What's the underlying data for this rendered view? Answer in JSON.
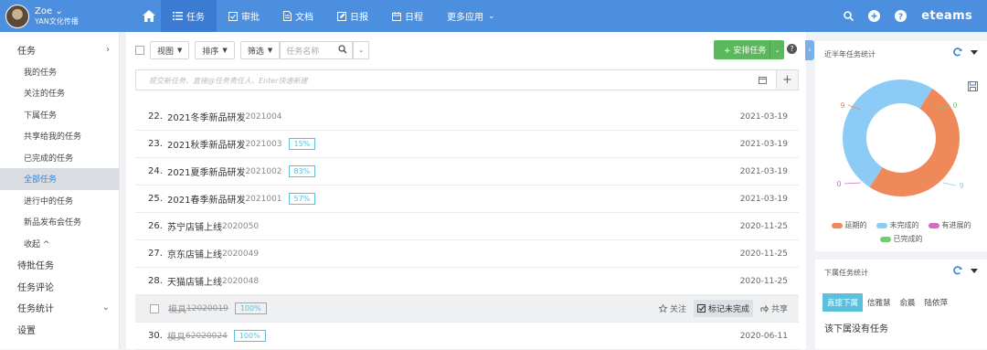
{
  "user": {
    "name": "Zoe",
    "org": "YAN文化传播"
  },
  "nav": {
    "items": [
      "任务",
      "审批",
      "文档",
      "日报",
      "日程",
      "更多应用"
    ],
    "brand": "eteams"
  },
  "sidebar": {
    "items": [
      {
        "label": "任务",
        "sub": false,
        "arrow": "›"
      },
      {
        "label": "我的任务",
        "sub": true
      },
      {
        "label": "关注的任务",
        "sub": true
      },
      {
        "label": "下属任务",
        "sub": true
      },
      {
        "label": "共享给我的任务",
        "sub": true
      },
      {
        "label": "已完成的任务",
        "sub": true
      },
      {
        "label": "全部任务",
        "sub": true,
        "active": true
      },
      {
        "label": "进行中的任务",
        "sub": true
      },
      {
        "label": "新品发布会任务",
        "sub": true
      },
      {
        "label": "收起 ^",
        "sub": true
      },
      {
        "label": "待批任务",
        "sub": false
      },
      {
        "label": "任务评论",
        "sub": false
      },
      {
        "label": "任务统计",
        "sub": false,
        "arrow": "⌄"
      },
      {
        "label": "设置",
        "sub": false
      }
    ]
  },
  "toolbar": {
    "view": "视图",
    "sort": "排序",
    "filter": "筛选",
    "search_placeholder": "任务名称",
    "add": "+ 安排任务"
  },
  "quick": {
    "placeholder": "提交新任务、直接@任务责任人、Enter快速新建"
  },
  "tasks": [
    {
      "num": "22.",
      "title": "2021冬季新品研发",
      "code": "2021004",
      "pct": "",
      "date": "2021-03-19",
      "done": false
    },
    {
      "num": "23.",
      "title": "2021秋季新品研发",
      "code": "2021003",
      "pct": "15%",
      "date": "2021-03-19",
      "done": false
    },
    {
      "num": "24.",
      "title": "2021夏季新品研发",
      "code": "2021002",
      "pct": "83%",
      "date": "2021-03-19",
      "done": false
    },
    {
      "num": "25.",
      "title": "2021春季新品研发",
      "code": "2021001",
      "pct": "57%",
      "date": "2021-03-19",
      "done": false
    },
    {
      "num": "26.",
      "title": "苏宁店铺上线",
      "code": "2020050",
      "pct": "",
      "date": "2020-11-25",
      "done": false
    },
    {
      "num": "27.",
      "title": "京东店铺上线",
      "code": "2020049",
      "pct": "",
      "date": "2020-11-25",
      "done": false
    },
    {
      "num": "28.",
      "title": "天猫店铺上线",
      "code": "2020048",
      "pct": "",
      "date": "2020-11-25",
      "done": false
    },
    {
      "num": "",
      "title": "模具",
      "code": "12020019",
      "pct": "100%",
      "date": "",
      "done": true,
      "hover": true
    },
    {
      "num": "30.",
      "title": "模具",
      "code": "62020024",
      "pct": "100%",
      "date": "2020-06-11",
      "done": true
    }
  ],
  "row_actions": {
    "follow": "关注",
    "mark": "标记未完成",
    "share": "共享"
  },
  "stats": {
    "title": "近半年任务统计",
    "chart_data": {
      "type": "pie",
      "categories": [
        "延期的",
        "未完成的",
        "有进展的",
        "已完成的"
      ],
      "values": [
        9,
        9,
        0,
        0
      ],
      "labels": [
        "9",
        "9",
        "0",
        "0"
      ],
      "colors": [
        "#f0895a",
        "#8ccbf5",
        "#d36cc7",
        "#6dcf6d"
      ],
      "legend": "bottom"
    }
  },
  "sub_stats": {
    "title": "下属任务统计",
    "tabs": [
      "直接下属",
      "信雅慧",
      "俞晨",
      "陆依萍"
    ],
    "empty": "该下属没有任务"
  }
}
